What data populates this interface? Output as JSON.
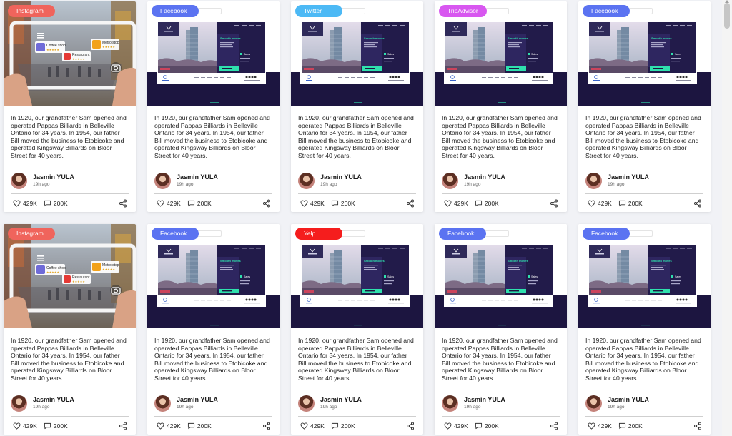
{
  "colors": {
    "instagram": "#f0645c",
    "facebook": "#5b73f1",
    "twitter": "#4cb9f5",
    "tripadvisor": "#d857f0",
    "yelp": "#f51d1d",
    "screen_bg": "#211a47",
    "accent_green": "#2fe0ad",
    "card_bg": "#ffffff"
  },
  "ar_preview": {
    "coffee_label": "Coffee shop",
    "coffee_stars": "★★★★★",
    "metro_label": "Metro stop",
    "metro_stars": "★★★★★",
    "restaurant_label": "Restaurant",
    "restaurant_stars": "★★★★★"
  },
  "site_preview": {
    "headline": "Smooth moves",
    "cta": "Sales"
  },
  "cards": [
    {
      "platform": "Instagram",
      "platform_key": "instagram",
      "media": "ar",
      "text": "In 1920, our grandfather Sam opened and operated Pappas Billiards in Belleville Ontario for 34 years. In 1954, our father Bill moved the business to Etobicoke and operated Kingsway Billiards on Bloor Street for 40 years.",
      "author": "Jasmin YULA",
      "time": "19h ago",
      "likes": "429K",
      "comments": "200K"
    },
    {
      "platform": "Facebook",
      "platform_key": "facebook",
      "media": "site",
      "text": "In 1920, our grandfather Sam opened and operated Pappas Billiards in Belleville Ontario for 34 years. In 1954, our father Bill moved the business to Etobicoke and operated Kingsway Billiards on Bloor Street for 40 years.",
      "author": "Jasmin YULA",
      "time": "19h ago",
      "likes": "429K",
      "comments": "200K"
    },
    {
      "platform": "Twitter",
      "platform_key": "twitter",
      "media": "site",
      "text": "In 1920, our grandfather Sam opened and operated Pappas Billiards in Belleville Ontario for 34 years. In 1954, our father Bill moved the business to Etobicoke and operated Kingsway Billiards on Bloor Street for 40 years.",
      "author": "Jasmin YULA",
      "time": "19h ago",
      "likes": "429K",
      "comments": "200K"
    },
    {
      "platform": "TripAdvisor",
      "platform_key": "tripadvisor",
      "media": "site",
      "text": "In 1920, our grandfather Sam opened and operated Pappas Billiards in Belleville Ontario for 34 years. In 1954, our father Bill moved the business to Etobicoke and operated Kingsway Billiards on Bloor Street for 40 years.",
      "author": "Jasmin YULA",
      "time": "19h ago",
      "likes": "429K",
      "comments": "200K"
    },
    {
      "platform": "Facebook",
      "platform_key": "facebook",
      "media": "site",
      "text": "In 1920, our grandfather Sam opened and operated Pappas Billiards in Belleville Ontario for 34 years. In 1954, our father Bill moved the business to Etobicoke and operated Kingsway Billiards on Bloor Street for 40 years.",
      "author": "Jasmin YULA",
      "time": "19h ago",
      "likes": "429K",
      "comments": "200K"
    },
    {
      "platform": "Instagram",
      "platform_key": "instagram",
      "media": "ar",
      "text": "In 1920, our grandfather Sam opened and operated Pappas Billiards in Belleville Ontario for 34 years. In 1954, our father Bill moved the business to Etobicoke and operated Kingsway Billiards on Bloor Street for 40 years.",
      "author": "Jasmin YULA",
      "time": "19h ago",
      "likes": "429K",
      "comments": "200K"
    },
    {
      "platform": "Facebook",
      "platform_key": "facebook",
      "media": "site",
      "text": "In 1920, our grandfather Sam opened and operated Pappas Billiards in Belleville Ontario for 34 years. In 1954, our father Bill moved the business to Etobicoke and operated Kingsway Billiards on Bloor Street for 40 years.",
      "author": "Jasmin YULA",
      "time": "19h ago",
      "likes": "429K",
      "comments": "200K"
    },
    {
      "platform": "Yelp",
      "platform_key": "yelp",
      "media": "site",
      "text": "In 1920, our grandfather Sam opened and operated Pappas Billiards in Belleville Ontario for 34 years. In 1954, our father Bill moved the business to Etobicoke and operated Kingsway Billiards on Bloor Street for 40 years.",
      "author": "Jasmin YULA",
      "time": "19h ago",
      "likes": "429K",
      "comments": "200K"
    },
    {
      "platform": "Facebook",
      "platform_key": "facebook",
      "media": "site",
      "text": "In 1920, our grandfather Sam opened and operated Pappas Billiards in Belleville Ontario for 34 years. In 1954, our father Bill moved the business to Etobicoke and operated Kingsway Billiards on Bloor Street for 40 years.",
      "author": "Jasmin YULA",
      "time": "19h ago",
      "likes": "429K",
      "comments": "200K"
    },
    {
      "platform": "Facebook",
      "platform_key": "facebook",
      "media": "site",
      "text": "In 1920, our grandfather Sam opened and operated Pappas Billiards in Belleville Ontario for 34 years. In 1954, our father Bill moved the business to Etobicoke and operated Kingsway Billiards on Bloor Street for 40 years.",
      "author": "Jasmin YULA",
      "time": "19h ago",
      "likes": "429K",
      "comments": "200K"
    }
  ]
}
